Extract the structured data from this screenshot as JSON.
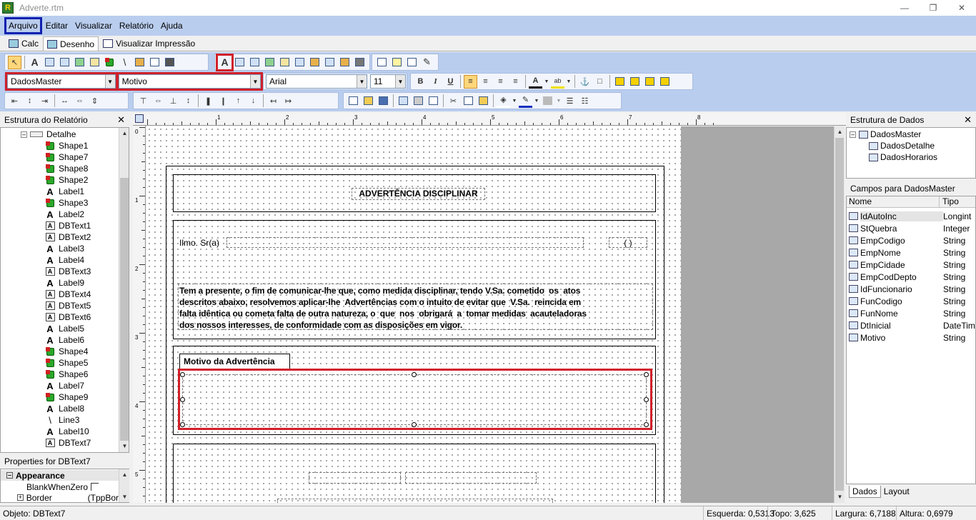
{
  "window": {
    "title": "Adverte.rtm",
    "app_icon": "R"
  },
  "menu": [
    "Arquivo",
    "Editar",
    "Visualizar",
    "Relatório",
    "Ajuda"
  ],
  "tabs": [
    "Calc",
    "Desenho",
    "Visualizar Impressão"
  ],
  "toolbar": {
    "datapipeline": "DadosMaster",
    "field": "Motivo",
    "font_name": "Arial",
    "font_size": "11",
    "bold": "B",
    "italic": "I",
    "underline": "U"
  },
  "report_tree": {
    "title": "Estrutura do Relatório",
    "root": "Detalhe",
    "items": [
      "Shape1",
      "Shape7",
      "Shape8",
      "Shape2",
      "Label1",
      "Shape3",
      "Label2",
      "DBText1",
      "DBText2",
      "Label3",
      "Label4",
      "DBText3",
      "Label9",
      "DBText4",
      "DBText5",
      "DBText6",
      "Label5",
      "Label6",
      "Shape4",
      "Shape5",
      "Shape6",
      "Label7",
      "Shape9",
      "Label8",
      "Line3",
      "Label10",
      "DBText7"
    ],
    "types": [
      "shape",
      "shape",
      "shape",
      "shape",
      "label",
      "shape",
      "label",
      "dbtext",
      "dbtext",
      "label",
      "label",
      "dbtext",
      "label",
      "dbtext",
      "dbtext",
      "dbtext",
      "label",
      "label",
      "shape",
      "shape",
      "shape",
      "label",
      "shape",
      "label",
      "line",
      "label",
      "dbtext"
    ]
  },
  "properties": {
    "title": "Properties for DBText7",
    "category": "Appearance",
    "rows": [
      {
        "name": "BlankWhenZero",
        "value": ""
      },
      {
        "name": "Border",
        "value": "(TppBor"
      }
    ]
  },
  "ruler_labels": [
    "1",
    "2",
    "3",
    "4",
    "5",
    "6",
    "7",
    "8"
  ],
  "ruler_left_labels": [
    "0",
    "1",
    "2",
    "3",
    "4",
    "5"
  ],
  "report": {
    "title": "ADVERTÊNCIA   DISCIPLINAR",
    "salutation": "Ilmo. Sr(a)",
    "paren": "(            )",
    "body_lines": [
      "Tem a presente, o fim de comunicar-lhe que, como medida disciplinar, tendo V.Sa. cometido  os  atos",
      "descritos abaixo, resolvemos aplicar-lhe  Advertências com o intuito de evitar que  V.Sa.  reincida em",
      "falta idêntica ou cometa falta de outra natureza, o  que  nos  obrigará  a  tomar medidas  acauteladoras",
      "dos nossos interesses, de conformidade com as disposições em vigor."
    ],
    "motivo_label": "Motivo da Advertência"
  },
  "data_tree": {
    "title": "Estrutura de Dados",
    "root": "DadosMaster",
    "children": [
      "DadosDetalhe",
      "DadosHorarios"
    ]
  },
  "fields_panel": {
    "title": "Campos para DadosMaster",
    "headers": [
      "Nome",
      "Tipo"
    ],
    "rows": [
      [
        "IdAutoInc",
        "Longint"
      ],
      [
        "StQuebra",
        "Integer"
      ],
      [
        "EmpCodigo",
        "String"
      ],
      [
        "EmpNome",
        "String"
      ],
      [
        "EmpCidade",
        "String"
      ],
      [
        "EmpCodDepto",
        "String"
      ],
      [
        "IdFuncionario",
        "String"
      ],
      [
        "FunCodigo",
        "String"
      ],
      [
        "FunNome",
        "String"
      ],
      [
        "DtInicial",
        "DateTim"
      ],
      [
        "Motivo",
        "String"
      ]
    ],
    "tabs": [
      "Dados",
      "Layout"
    ]
  },
  "status": {
    "object": "Objeto: DBText7",
    "left": "Esquerda: 0,5313",
    "top": "Topo: 3,625",
    "width": "Largura: 6,7188",
    "height": "Altura: 0,6979"
  },
  "colors": {
    "menu_bg": "#b9cdee",
    "highlight_red": "#d0202a",
    "highlight_blue": "#1020b0"
  }
}
